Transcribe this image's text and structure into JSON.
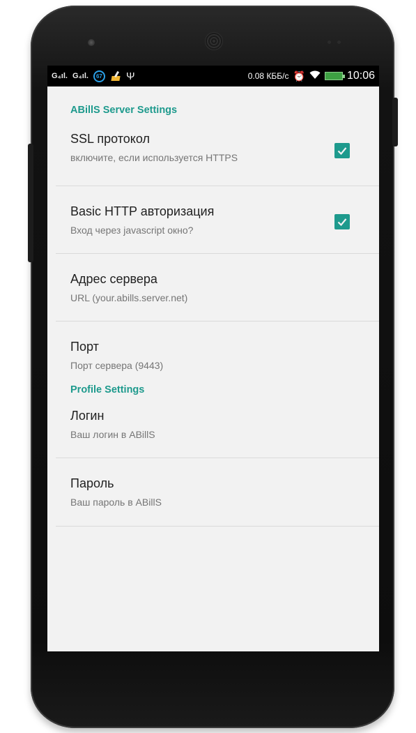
{
  "status_bar": {
    "signal1": "G₄ıl.",
    "signal2": "G₄ıl.",
    "badge": "67",
    "usb_icon": "usb-icon",
    "speed": "0.08 КББ/с",
    "time": "10:06"
  },
  "sections": [
    {
      "header": "ABillS Server Settings",
      "items": [
        {
          "title": "SSL протокол",
          "summary": "включите, если используется HTTPS",
          "checked": true
        },
        {
          "title": "Basic HTTP авторизация",
          "summary": "Вход через javascript окно?",
          "checked": true
        },
        {
          "title": "Адрес сервера",
          "summary": "URL (your.abills.server.net)"
        },
        {
          "title": "Порт",
          "summary": "Порт сервера (9443)"
        }
      ]
    },
    {
      "header": "Profile Settings",
      "items": [
        {
          "title": "Логин",
          "summary": "Ваш логин в ABillS"
        },
        {
          "title": "Пароль",
          "summary": "Ваш пароль в ABillS"
        }
      ]
    }
  ],
  "colors": {
    "accent": "#1e9a8d",
    "background": "#f2f2f2",
    "status_bar": "#000000"
  }
}
